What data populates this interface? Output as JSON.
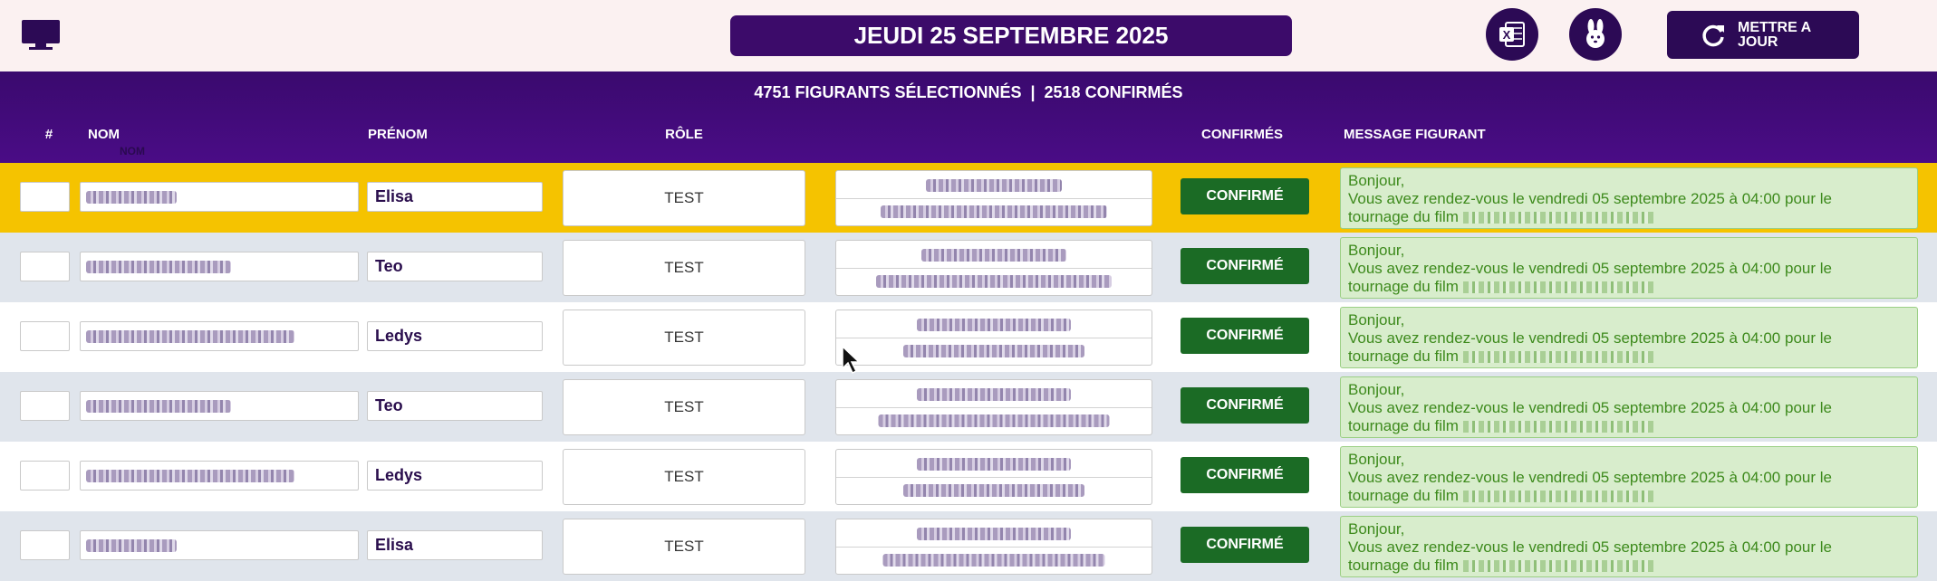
{
  "topbar": {
    "date": "JEUDI 25 SEPTEMBRE 2025",
    "refresh_label": "METTRE A JOUR",
    "icons": [
      "monitor-icon",
      "excel-icon",
      "rabbit-icon",
      "refresh-icon"
    ]
  },
  "header": {
    "counts": "4751 FIGURANTS SÉLECTIONNÉS  |  2518 CONFIRMÉS",
    "col_num": "#",
    "col_nom": "NOM",
    "col_prenom": "PRÉNOM",
    "col_role": "RÔLE",
    "col_confirmes": "CONFIRMÉS",
    "col_message": "MESSAGE FIGURANT",
    "ghost_label": "NOM"
  },
  "rows": [
    {
      "prenom": "Elisa",
      "role": "TEST",
      "status": "CONFIRMÉ",
      "msg_line1": "Bonjour,",
      "msg_line2": "Vous avez rendez-vous le vendredi 05 septembre 2025 à 04:00 pour le",
      "msg_line3": "tournage du film"
    },
    {
      "prenom": "Teo",
      "role": "TEST",
      "status": "CONFIRMÉ",
      "msg_line1": "Bonjour,",
      "msg_line2": "Vous avez rendez-vous le vendredi 05 septembre 2025 à 04:00 pour le",
      "msg_line3": "tournage du film"
    },
    {
      "prenom": "Ledys",
      "role": "TEST",
      "status": "CONFIRMÉ",
      "msg_line1": "Bonjour,",
      "msg_line2": "Vous avez rendez-vous le vendredi 05 septembre 2025 à 04:00 pour le",
      "msg_line3": "tournage du film"
    },
    {
      "prenom": "Teo",
      "role": "TEST",
      "status": "CONFIRMÉ",
      "msg_line1": "Bonjour,",
      "msg_line2": "Vous avez rendez-vous le vendredi 05 septembre 2025 à 04:00 pour le",
      "msg_line3": "tournage du film"
    },
    {
      "prenom": "Ledys",
      "role": "TEST",
      "status": "CONFIRMÉ",
      "msg_line1": "Bonjour,",
      "msg_line2": "Vous avez rendez-vous le vendredi 05 septembre 2025 à 04:00 pour le",
      "msg_line3": "tournage du film"
    },
    {
      "prenom": "Elisa",
      "role": "TEST",
      "status": "CONFIRMÉ",
      "msg_line1": "Bonjour,",
      "msg_line2": "Vous avez rendez-vous le vendredi 05 septembre 2025 à 04:00 pour le",
      "msg_line3": "tournage du film"
    }
  ],
  "colors": {
    "brand_purple": "#3c0b6a",
    "highlight_row": "#f5c300",
    "confirm_green": "#1b6b25",
    "message_bg": "#d8edcc",
    "message_text": "#3d8a1c"
  }
}
